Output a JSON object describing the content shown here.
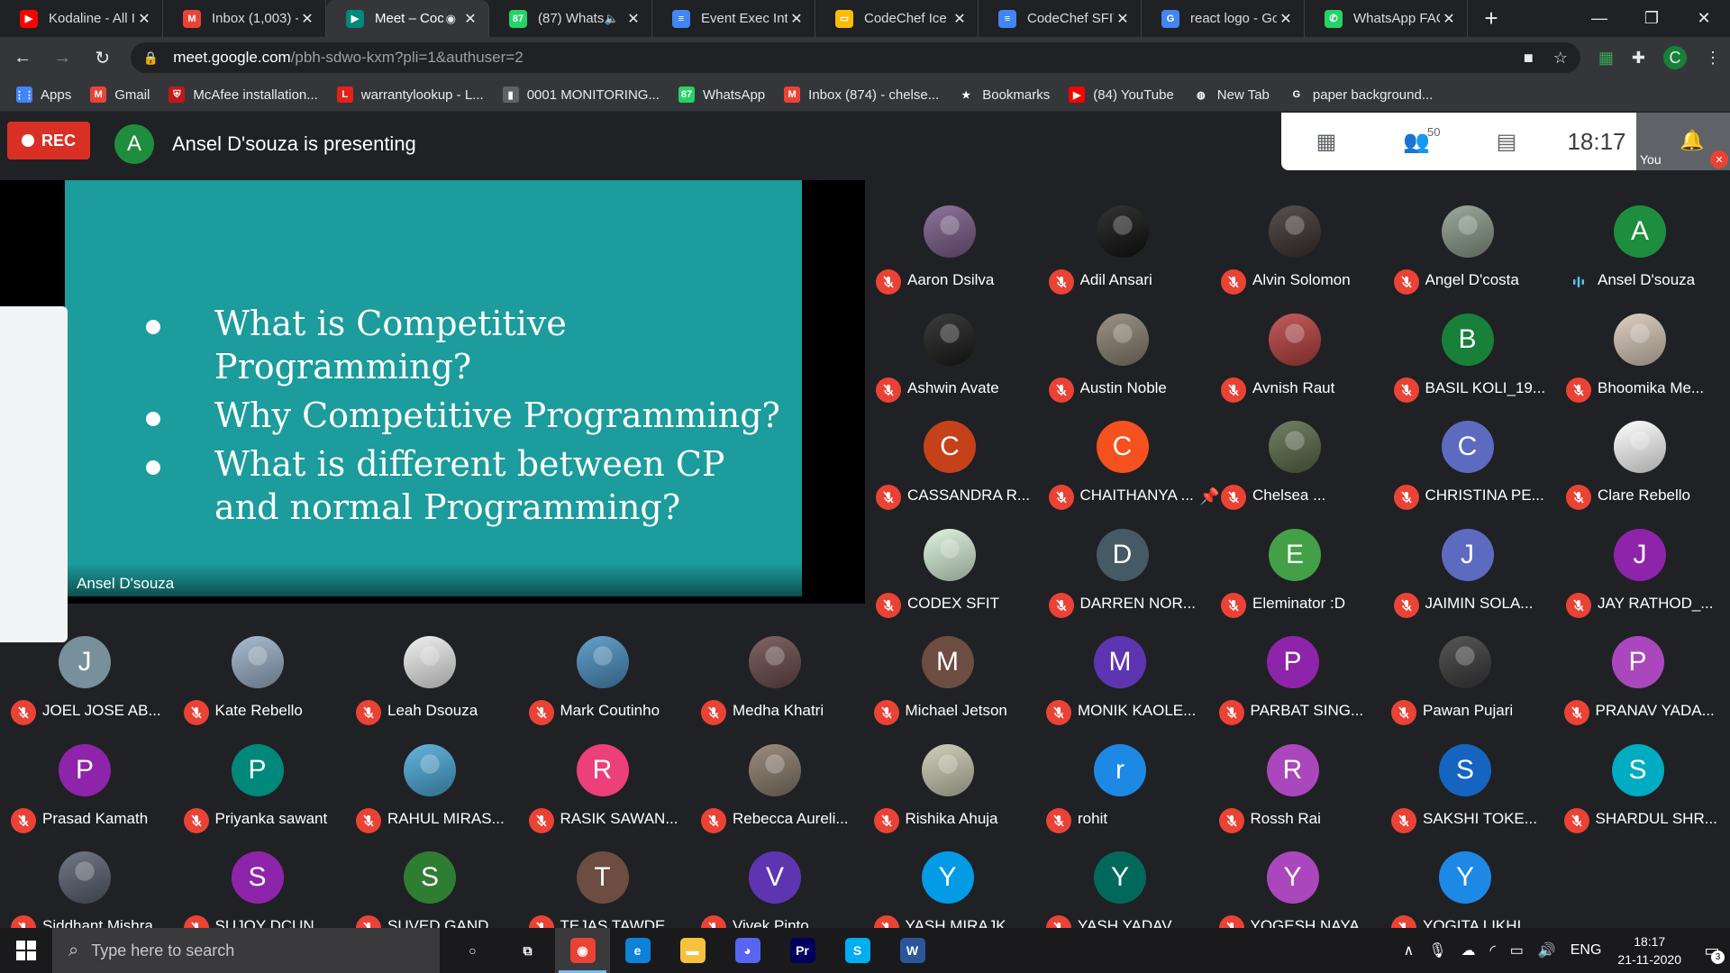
{
  "browser": {
    "tabs": [
      {
        "title": "Kodaline - All I",
        "favicon_color": "#ff0000",
        "favicon_glyph": "▶",
        "active": false
      },
      {
        "title": "Inbox (1,003) -",
        "favicon_color": "#ea4335",
        "favicon_glyph": "M",
        "active": false
      },
      {
        "title": "Meet – Coc",
        "favicon_color": "#00897b",
        "favicon_glyph": "▶",
        "active": true
      },
      {
        "title": "(87) Whats",
        "favicon_color": "#25d366",
        "favicon_glyph": "87",
        "active": false
      },
      {
        "title": "Event Exec Inte",
        "favicon_color": "#4285f4",
        "favicon_glyph": "≡",
        "active": false
      },
      {
        "title": "CodeChef Ice B",
        "favicon_color": "#fbbc04",
        "favicon_glyph": "▭",
        "active": false
      },
      {
        "title": "CodeChef SFIT",
        "favicon_color": "#4285f4",
        "favicon_glyph": "≡",
        "active": false
      },
      {
        "title": "react logo - Go",
        "favicon_color": "#4285f4",
        "favicon_glyph": "G",
        "active": false
      },
      {
        "title": "WhatsApp FAC",
        "favicon_color": "#25d366",
        "favicon_glyph": "✆",
        "active": false
      }
    ],
    "new_tab_glyph": "+",
    "window_controls": {
      "minimize": "—",
      "restore": "❐",
      "close": "✕"
    },
    "url_host": "meet.google.com",
    "url_path": "/pbh-sdwo-kxm?pli=1&authuser=2",
    "profile_letter": "C",
    "bookmarks": [
      {
        "label": "Apps",
        "icon_color": "#4285f4",
        "glyph": "⋮⋮"
      },
      {
        "label": "Gmail",
        "icon_color": "#ea4335",
        "glyph": "M"
      },
      {
        "label": "McAfee installation...",
        "icon_color": "#c01818",
        "glyph": "⛨"
      },
      {
        "label": "warrantylookup - L...",
        "icon_color": "#e2231a",
        "glyph": "L"
      },
      {
        "label": "0001 MONITORING...",
        "icon_color": "#5f6368",
        "glyph": "▮"
      },
      {
        "label": "WhatsApp",
        "icon_color": "#25d366",
        "glyph": "87"
      },
      {
        "label": "Inbox (874) - chelse...",
        "icon_color": "#ea4335",
        "glyph": "M"
      },
      {
        "label": "Bookmarks",
        "icon_color": "transparent",
        "glyph": "★"
      },
      {
        "label": "(84) YouTube",
        "icon_color": "#ff0000",
        "glyph": "▶"
      },
      {
        "label": "New Tab",
        "icon_color": "transparent",
        "glyph": "◍"
      },
      {
        "label": "paper background...",
        "icon_color": "transparent",
        "glyph": "G"
      }
    ]
  },
  "meet": {
    "rec_label": "REC",
    "presenter_initial": "A",
    "presenter_text": "Ansel D'souza is presenting",
    "participant_count": "50",
    "clock": "18:17",
    "you_label": "You",
    "slide_bullets": [
      "What is Competitive Programming?",
      "Why Competitive Programming?",
      "What is different between CP and normal Programming?"
    ],
    "slide_presenter": "Ansel D'souza",
    "participants": [
      {
        "name": "Aaron Dsilva",
        "initial": "",
        "color": "#7a5c8a",
        "photo": true,
        "speaking": false
      },
      {
        "name": "Adil Ansari",
        "initial": "",
        "color": "#111111",
        "photo": true,
        "speaking": false
      },
      {
        "name": "Alvin Solomon",
        "initial": "",
        "color": "#3a3230",
        "photo": true,
        "speaking": false
      },
      {
        "name": "Angel D'costa",
        "initial": "",
        "color": "#8a9a8a",
        "photo": true,
        "speaking": false
      },
      {
        "name": "Ansel D'souza",
        "initial": "A",
        "color": "#1e8e3e",
        "photo": false,
        "speaking": true
      },
      {
        "name": "Ashwin Avate",
        "initial": "",
        "color": "#1a1a1a",
        "photo": true,
        "speaking": false
      },
      {
        "name": "Austin Noble",
        "initial": "",
        "color": "#8a8070",
        "photo": true,
        "speaking": false
      },
      {
        "name": "Avnish Raut",
        "initial": "",
        "color": "#b84040",
        "photo": true,
        "speaking": false
      },
      {
        "name": "BASIL KOLI_19...",
        "initial": "B",
        "color": "#188038",
        "photo": false,
        "speaking": false
      },
      {
        "name": "Bhoomika Me...",
        "initial": "",
        "color": "#d8c8b8",
        "photo": true,
        "speaking": false
      },
      {
        "name": "CASSANDRA R...",
        "initial": "C",
        "color": "#c5411a",
        "photo": false,
        "speaking": false
      },
      {
        "name": "CHAITHANYA ...",
        "initial": "C",
        "color": "#f4511e",
        "photo": false,
        "speaking": false
      },
      {
        "name": "Chelsea ...",
        "initial": "",
        "color": "#5a6a4a",
        "photo": true,
        "speaking": false,
        "pinned": true
      },
      {
        "name": "CHRISTINA PE...",
        "initial": "C",
        "color": "#5c6bc0",
        "photo": false,
        "speaking": false
      },
      {
        "name": "Clare Rebello",
        "initial": "",
        "color": "#ffffff",
        "photo": true,
        "speaking": false
      },
      {
        "name": "CODEX SFIT",
        "initial": "",
        "color": "#d8f0d8",
        "photo": true,
        "speaking": false
      },
      {
        "name": "DARREN NOR...",
        "initial": "D",
        "color": "#455a64",
        "photo": false,
        "speaking": false
      },
      {
        "name": "Eleminator :D",
        "initial": "E",
        "color": "#43a047",
        "photo": false,
        "speaking": false
      },
      {
        "name": "JAIMIN SOLA...",
        "initial": "J",
        "color": "#5c6bc0",
        "photo": false,
        "speaking": false
      },
      {
        "name": "JAY RATHOD_...",
        "initial": "J",
        "color": "#8e24aa",
        "photo": false,
        "speaking": false
      },
      {
        "name": "JOEL JOSE AB...",
        "initial": "J",
        "color": "#78909c",
        "photo": false,
        "speaking": false
      },
      {
        "name": "Kate Rebello",
        "initial": "",
        "color": "#9ab0c8",
        "photo": true,
        "speaking": false
      },
      {
        "name": "Leah Dsouza",
        "initial": "",
        "color": "#eeeeee",
        "photo": true,
        "speaking": false
      },
      {
        "name": "Mark Coutinho",
        "initial": "",
        "color": "#4a90c0",
        "photo": true,
        "speaking": false
      },
      {
        "name": "Medha Khatri",
        "initial": "",
        "color": "#6a4a4a",
        "photo": true,
        "speaking": false
      },
      {
        "name": "Michael Jetson",
        "initial": "M",
        "color": "#6d4c41",
        "photo": false,
        "speaking": false
      },
      {
        "name": "MONIK KAOLE...",
        "initial": "M",
        "color": "#5e35b1",
        "photo": false,
        "speaking": false
      },
      {
        "name": "PARBAT SING...",
        "initial": "P",
        "color": "#8e24aa",
        "photo": false,
        "speaking": false
      },
      {
        "name": "Pawan Pujari",
        "initial": "",
        "color": "#3a3a3a",
        "photo": true,
        "speaking": false
      },
      {
        "name": "PRANAV YADA...",
        "initial": "P",
        "color": "#ab47bc",
        "photo": false,
        "speaking": false
      },
      {
        "name": "Prasad Kamath",
        "initial": "P",
        "color": "#8e24aa",
        "photo": false,
        "speaking": false
      },
      {
        "name": "Priyanka sawant",
        "initial": "P",
        "color": "#00897b",
        "photo": false,
        "speaking": false
      },
      {
        "name": "RAHUL MIRAS...",
        "initial": "",
        "color": "#4aa8d8",
        "photo": true,
        "speaking": false
      },
      {
        "name": "RASIK SAWAN...",
        "initial": "R",
        "color": "#ec407a",
        "photo": false,
        "speaking": false
      },
      {
        "name": "Rebecca Aureli...",
        "initial": "",
        "color": "#8a7a6a",
        "photo": true,
        "speaking": false
      },
      {
        "name": "Rishika Ahuja",
        "initial": "",
        "color": "#c8c8b0",
        "photo": true,
        "speaking": false
      },
      {
        "name": "rohit",
        "initial": "r",
        "color": "#1e88e5",
        "photo": false,
        "speaking": false
      },
      {
        "name": "Rossh Rai",
        "initial": "R",
        "color": "#ab47bc",
        "photo": false,
        "speaking": false
      },
      {
        "name": "SAKSHI TOKE...",
        "initial": "S",
        "color": "#1565c0",
        "photo": false,
        "speaking": false
      },
      {
        "name": "SHARDUL SHR...",
        "initial": "S",
        "color": "#00acc1",
        "photo": false,
        "speaking": false
      },
      {
        "name": "Siddhant Mishra",
        "initial": "",
        "color": "#5a6070",
        "photo": true,
        "speaking": false
      },
      {
        "name": "SUJOY DCUN...",
        "initial": "S",
        "color": "#8e24aa",
        "photo": false,
        "speaking": false
      },
      {
        "name": "SUVED GAND...",
        "initial": "S",
        "color": "#2e7d32",
        "photo": false,
        "speaking": false
      },
      {
        "name": "TEJAS TAWDE...",
        "initial": "T",
        "color": "#6d4c41",
        "photo": false,
        "speaking": false
      },
      {
        "name": "Vivek Pinto",
        "initial": "V",
        "color": "#5e35b1",
        "photo": false,
        "speaking": false
      },
      {
        "name": "YASH MIRAJK...",
        "initial": "Y",
        "color": "#039be5",
        "photo": false,
        "speaking": false
      },
      {
        "name": "YASH YADAV_...",
        "initial": "Y",
        "color": "#00695c",
        "photo": false,
        "speaking": false
      },
      {
        "name": "YOGESH NAYA...",
        "initial": "Y",
        "color": "#ab47bc",
        "photo": false,
        "speaking": false
      },
      {
        "name": "YOGITA LIKHI_...",
        "initial": "Y",
        "color": "#1e88e5",
        "photo": false,
        "speaking": false
      }
    ]
  },
  "taskbar": {
    "search_placeholder": "Type here to search",
    "apps": [
      {
        "name": "cortana",
        "glyph": "○",
        "color": "transparent",
        "active": false
      },
      {
        "name": "task-view",
        "glyph": "⧉",
        "color": "transparent",
        "active": false
      },
      {
        "name": "chrome",
        "glyph": "◉",
        "color": "#ea4335",
        "active": true
      },
      {
        "name": "edge",
        "glyph": "e",
        "color": "#0c83d9",
        "active": false
      },
      {
        "name": "file-explorer",
        "glyph": "▬",
        "color": "#f6c23e",
        "active": false
      },
      {
        "name": "discord",
        "glyph": "◕",
        "color": "#5865f2",
        "active": false
      },
      {
        "name": "premiere-pro",
        "glyph": "Pr",
        "color": "#00005b",
        "active": false
      },
      {
        "name": "skype",
        "glyph": "S",
        "color": "#00aff0",
        "active": false
      },
      {
        "name": "word",
        "glyph": "W",
        "color": "#2b579a",
        "active": false
      }
    ],
    "language": "ENG",
    "time": "18:17",
    "date": "21-11-2020",
    "notification_count": "3"
  }
}
